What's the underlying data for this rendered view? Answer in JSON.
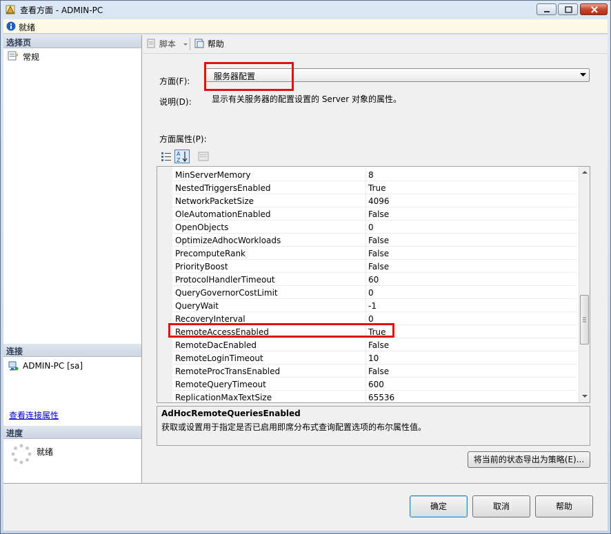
{
  "window": {
    "title": "查看方面 - ADMIN-PC"
  },
  "status": {
    "text": "就绪"
  },
  "left": {
    "select_page_header": "选择页",
    "pages": [
      {
        "label": "常规"
      }
    ],
    "connection_header": "连接",
    "connection_item": "ADMIN-PC [sa]",
    "view_connection_link": "查看连接属性",
    "progress_header": "进度",
    "progress_status": "就绪"
  },
  "toolbar": {
    "script_label": "脚本",
    "help_label": "帮助"
  },
  "facet": {
    "label": "方面(F):",
    "value": "服务器配置",
    "description_label": "说明(D):",
    "description": "显示有关服务器的配置设置的 Server 对象的属性。",
    "properties_label": "方面属性(P):"
  },
  "properties": [
    {
      "name": "MinServerMemory",
      "value": "8"
    },
    {
      "name": "NestedTriggersEnabled",
      "value": "True"
    },
    {
      "name": "NetworkPacketSize",
      "value": "4096"
    },
    {
      "name": "OleAutomationEnabled",
      "value": "False"
    },
    {
      "name": "OpenObjects",
      "value": "0"
    },
    {
      "name": "OptimizeAdhocWorkloads",
      "value": "False"
    },
    {
      "name": "PrecomputeRank",
      "value": "False"
    },
    {
      "name": "PriorityBoost",
      "value": "False"
    },
    {
      "name": "ProtocolHandlerTimeout",
      "value": "60"
    },
    {
      "name": "QueryGovernorCostLimit",
      "value": "0"
    },
    {
      "name": "QueryWait",
      "value": "-1"
    },
    {
      "name": "RecoveryInterval",
      "value": "0"
    },
    {
      "name": "RemoteAccessEnabled",
      "value": "True"
    },
    {
      "name": "RemoteDacEnabled",
      "value": "False"
    },
    {
      "name": "RemoteLoginTimeout",
      "value": "10"
    },
    {
      "name": "RemoteProcTransEnabled",
      "value": "False"
    },
    {
      "name": "RemoteQueryTimeout",
      "value": "600"
    },
    {
      "name": "ReplicationMaxTextSize",
      "value": "65536"
    }
  ],
  "help_pane": {
    "title": "AdHocRemoteQueriesEnabled",
    "text": "获取或设置用于指定是否已启用即席分布式查询配置选项的布尔属性值。"
  },
  "buttons": {
    "export": "将当前的状态导出为策略(E)...",
    "ok": "确定",
    "cancel": "取消",
    "help": "帮助"
  },
  "colors": {
    "highlight": "#e01010",
    "link": "#0000cc"
  }
}
